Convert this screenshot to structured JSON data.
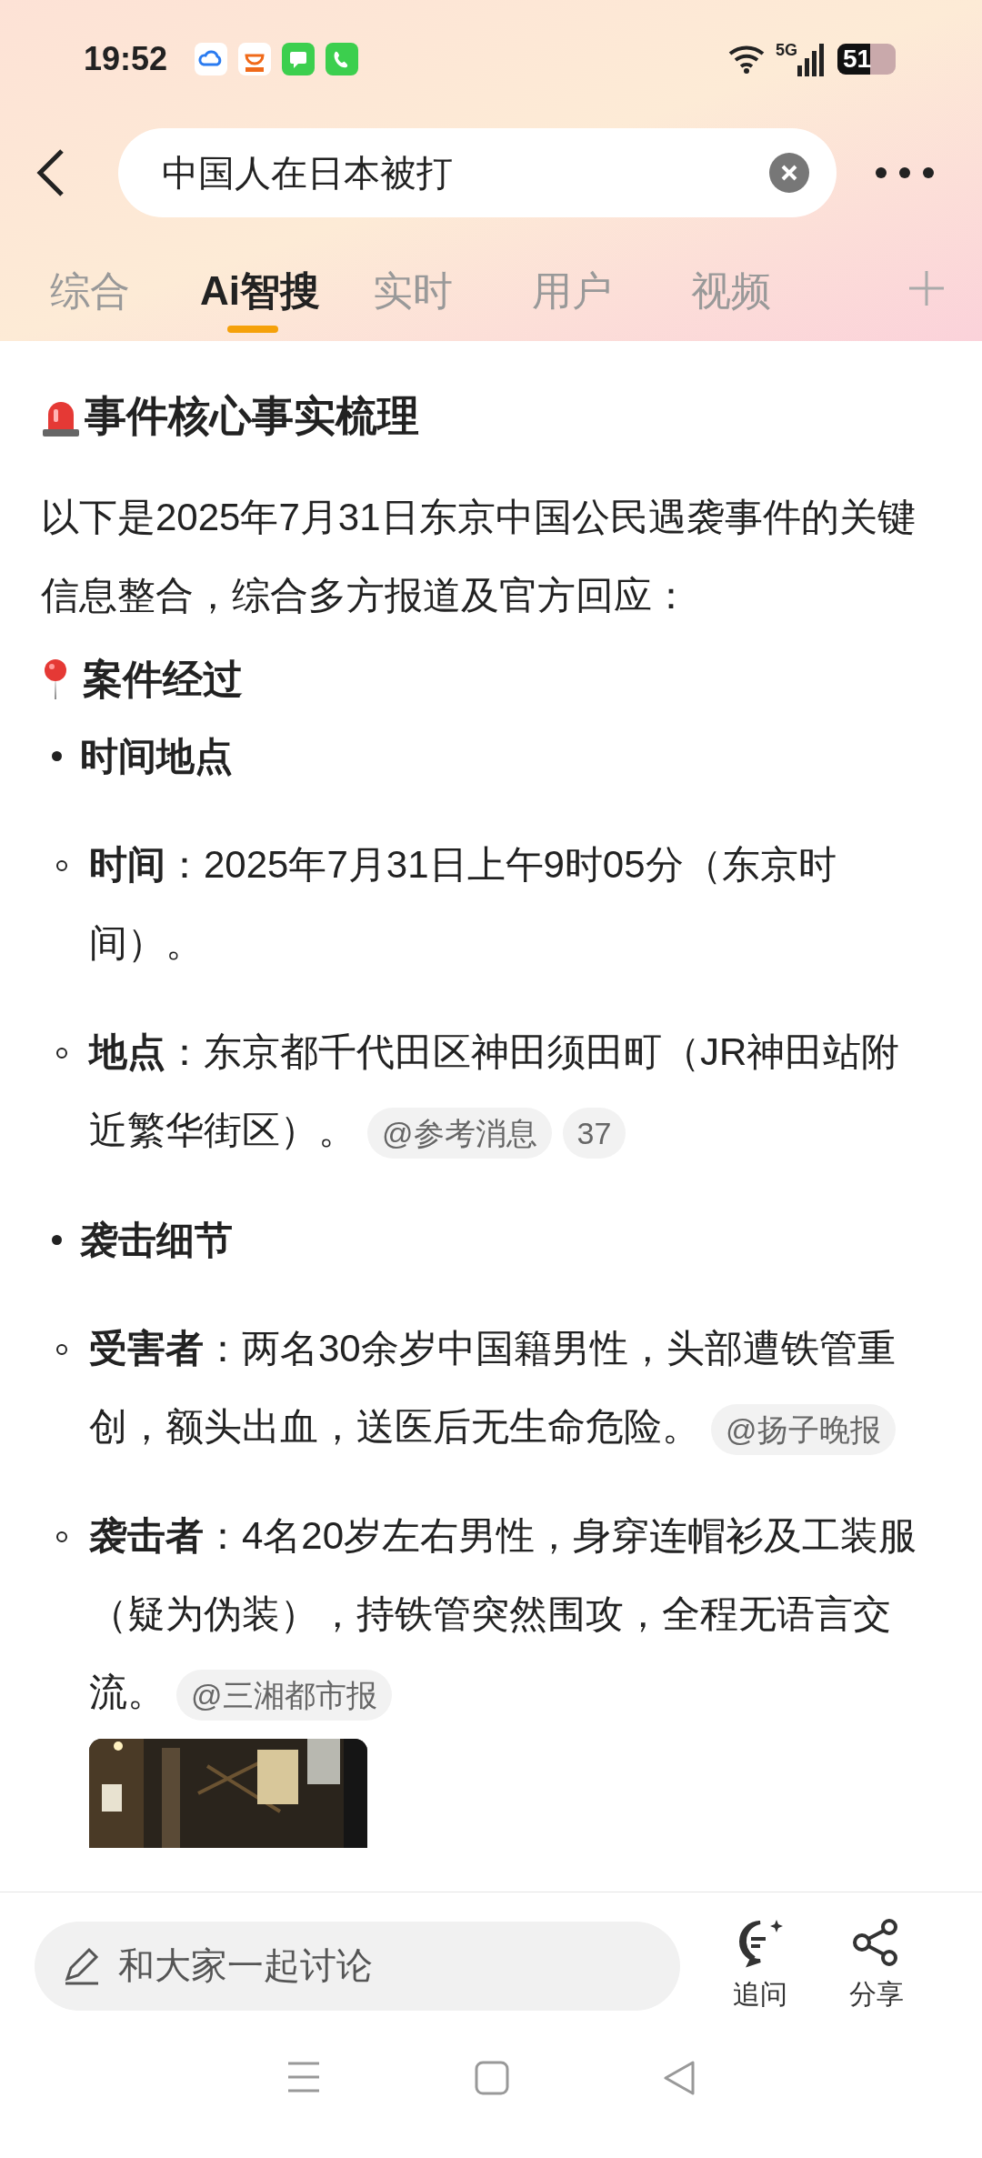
{
  "status_bar": {
    "time": "19:52",
    "network": "5G",
    "battery": "51"
  },
  "search": {
    "value": "中国人在日本被打"
  },
  "tabs": [
    {
      "label": "综合",
      "selected": false
    },
    {
      "label": "Ai智搜",
      "selected": true
    },
    {
      "label": "实时",
      "selected": false
    },
    {
      "label": "用户",
      "selected": false
    },
    {
      "label": "视频",
      "selected": false
    }
  ],
  "article": {
    "heading": "事件核心事实梳理",
    "intro": "以下是2025年7月31日东京中国公民遇袭事件的关键信息整合，综合多方报道及官方回应：",
    "section": {
      "title": "案件经过",
      "items": [
        {
          "label": "时间地点",
          "children": [
            {
              "text": "**时间**：2025年7月31日上午9时05分（东京时间）。"
            },
            {
              "text": "**地点**：东京都千代田区神田须田町（JR神田站附近繁华街区）。",
              "sources": [
                "@参考消息",
                "37"
              ]
            }
          ]
        },
        {
          "label": "袭击细节",
          "children": [
            {
              "text": "**受害者**：两名30余岁中国籍男性，头部遭铁管重创，额头出血，送医后无生命危险。",
              "sources": [
                "@扬子晚报"
              ]
            },
            {
              "text": "**袭击者**：4名20岁左右男性，身穿连帽衫及工装服（疑为伪装），持铁管突然围攻，全程无语言交流。",
              "sources": [
                "@三湘都市报"
              ],
              "media": {
                "kind": "picture"
              }
            }
          ]
        }
      ]
    }
  },
  "bottom_bar": {
    "comment": {
      "placeholder": "和大家一起讨论"
    },
    "actions": [
      {
        "kind": "ask",
        "label": "追问"
      },
      {
        "kind": "share",
        "label": "分享"
      }
    ]
  }
}
